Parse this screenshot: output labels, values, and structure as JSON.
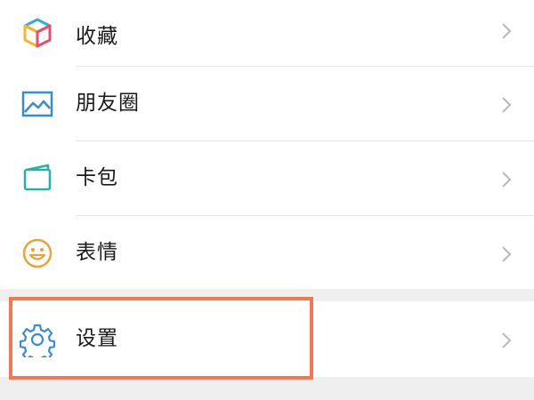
{
  "menu": {
    "items": [
      {
        "label": "收藏",
        "icon": "favorites-cube-icon"
      },
      {
        "label": "朋友圈",
        "icon": "moments-image-icon"
      },
      {
        "label": "卡包",
        "icon": "card-wallet-icon"
      },
      {
        "label": "表情",
        "icon": "sticker-smiley-icon"
      }
    ],
    "settings": {
      "label": "设置",
      "icon": "gear-icon"
    }
  },
  "colors": {
    "highlight_border": "#f07852",
    "icon_blue": "#3a8bd6",
    "icon_teal": "#27b0a8",
    "icon_yellow": "#f5b62e",
    "icon_orange_smiley": "#e9a33a",
    "background": "#efefef"
  }
}
